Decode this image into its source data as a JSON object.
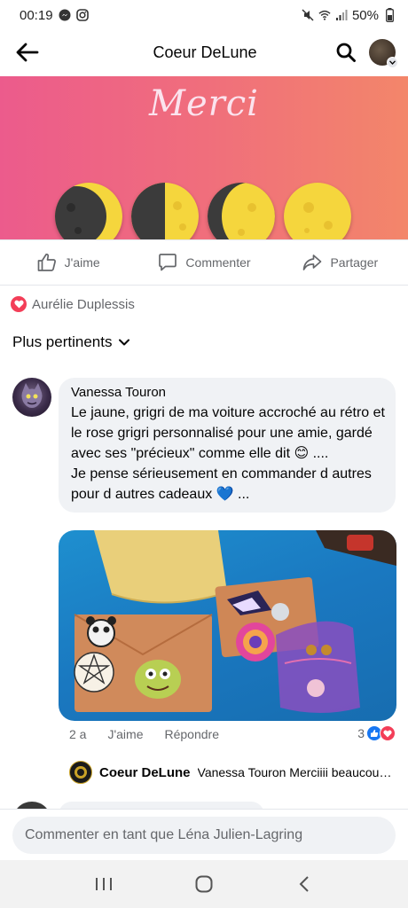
{
  "status_bar": {
    "time": "00:19",
    "battery": "50%"
  },
  "header": {
    "title": "Coeur DeLune"
  },
  "post": {
    "banner_text": "Merci",
    "actions": {
      "like": "J'aime",
      "comment": "Commenter",
      "share": "Partager"
    },
    "reactor_name": "Aurélie Duplessis"
  },
  "sort": {
    "label": "Plus pertinents"
  },
  "comment": {
    "author": "Vanessa Touron",
    "text": "Le jaune, grigri de ma voiture accroché au rétro et le rose grigri personnalisé pour une amie, gardé avec ses \"précieux\" comme elle dit 😊 ....\nJe pense sérieusement en commander d autres pour d autres cadeaux 💙 ...",
    "age": "2 a",
    "like_label": "J'aime",
    "reply_label": "Répondre",
    "reaction_count": "3"
  },
  "reply": {
    "author": "Coeur DeLune",
    "text": "Vanessa Touron Merciiii beaucoup pour ce retour"
  },
  "composer": {
    "placeholder": "Commenter en tant que Léna Julien-Lagring"
  },
  "colors": {
    "banner_start": "#ec5b8c",
    "banner_end": "#f3866a",
    "photo_bg": "#1a78c0",
    "like_blue": "#1877f2",
    "love_red": "#f33e58",
    "moon_yellow": "#f5d63d"
  }
}
